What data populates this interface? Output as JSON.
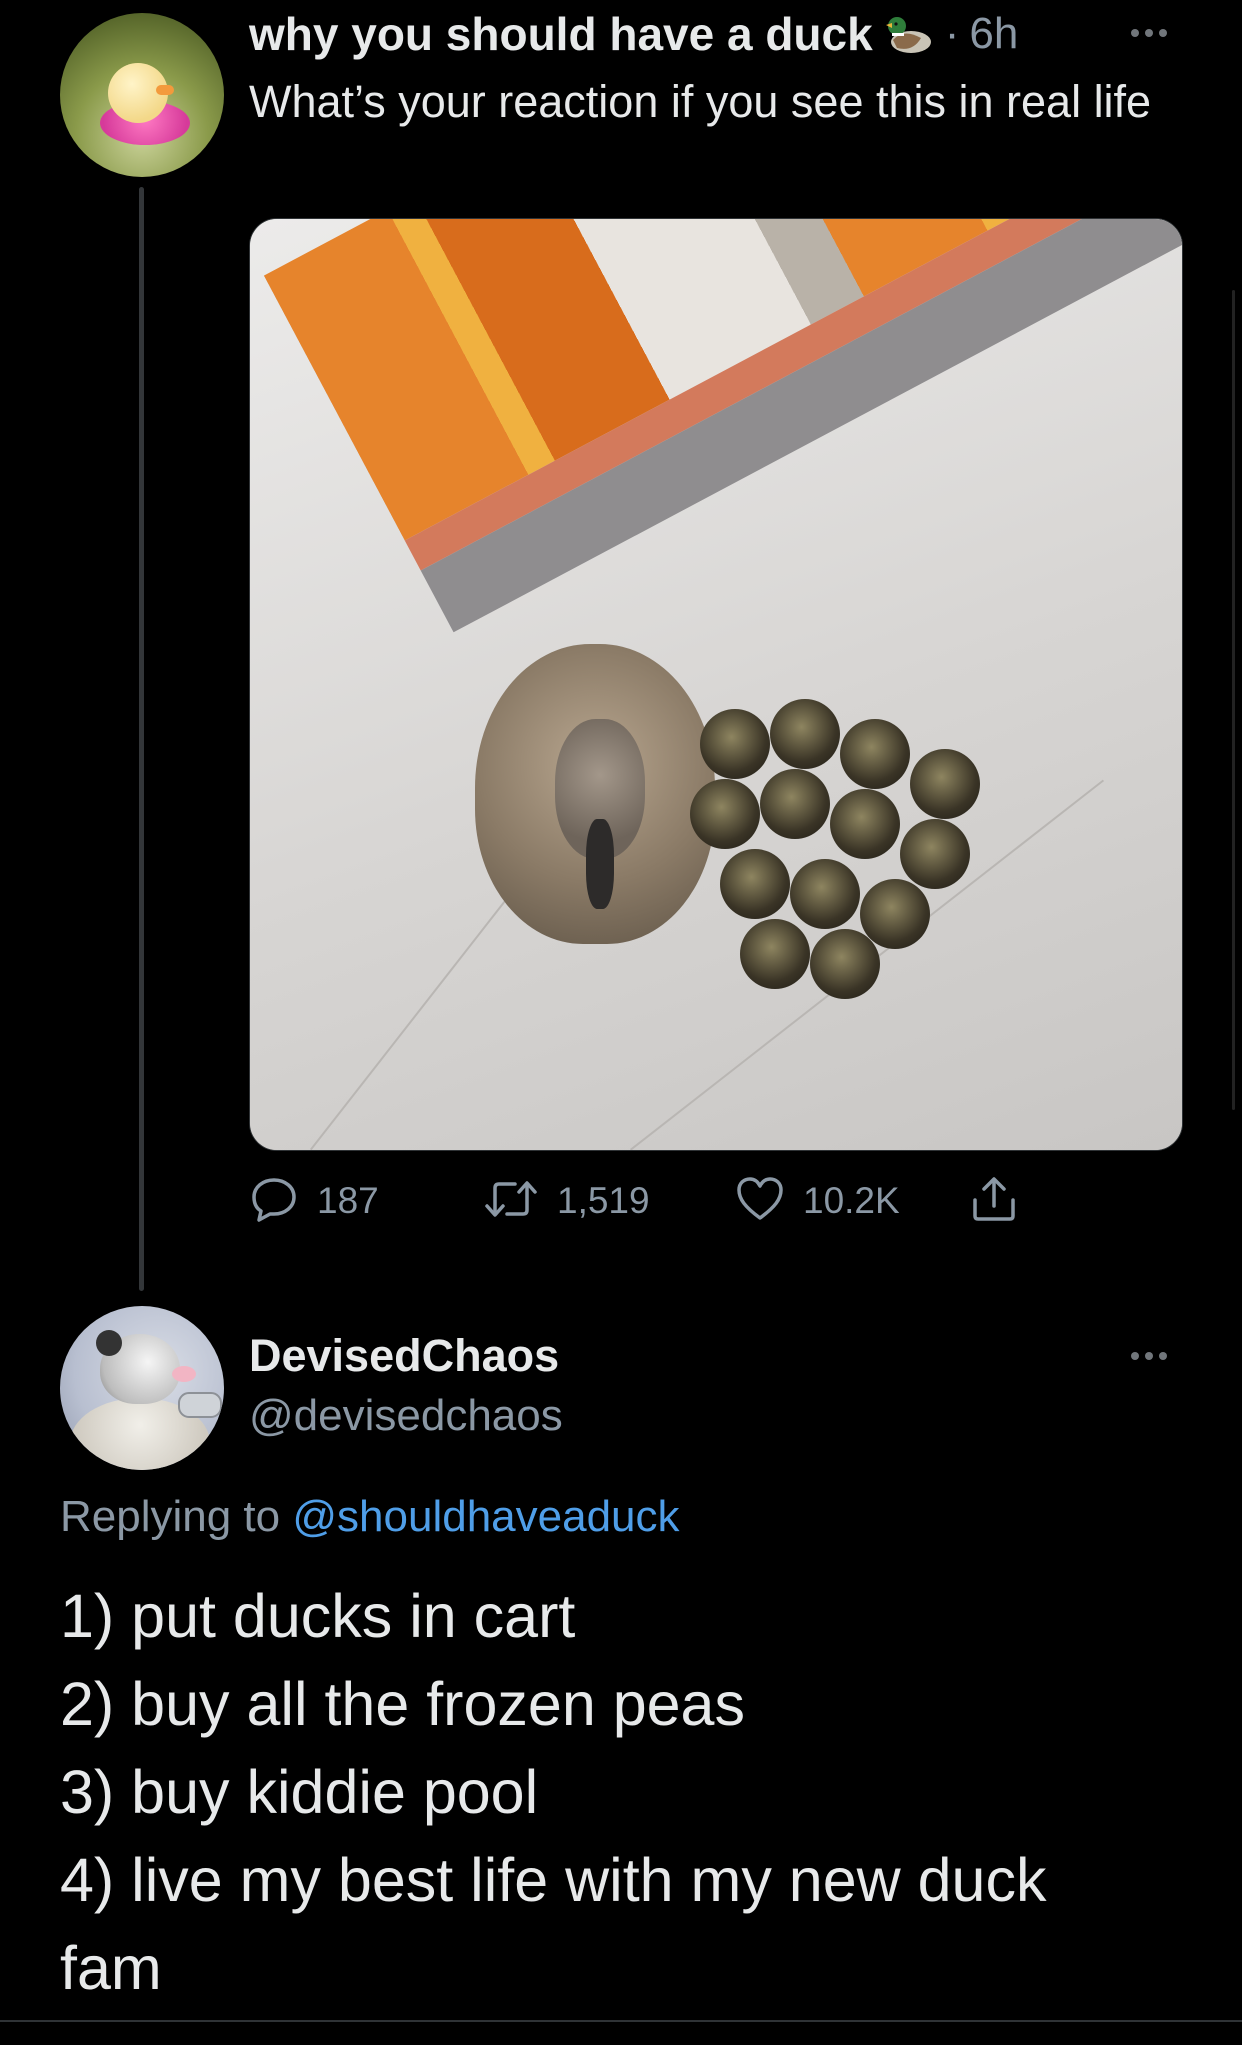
{
  "tweet": {
    "author_name": "why you should have a duck",
    "author_emoji_icon": "mallard-duck-icon",
    "separator": "·",
    "timestamp": "6h",
    "text": "What’s your reaction if you see this in real life",
    "actions": {
      "replies": "187",
      "retweets": "1,519",
      "likes": "10.2K"
    }
  },
  "reply": {
    "author_name": "DevisedChaos",
    "author_handle": "@devisedchaos",
    "replying_to_prefix": "Replying to",
    "replying_to_handle": "@shouldhaveaduck",
    "lines": [
      "1) put ducks in cart",
      "2) buy all the frozen peas",
      "3) buy kiddie pool",
      "4) live my best life with my new duck",
      "fam"
    ]
  },
  "colors": {
    "background": "#000000",
    "primary_text": "#e7e9ea",
    "secondary_text": "#8b98a5",
    "link": "#4f9ee8"
  }
}
